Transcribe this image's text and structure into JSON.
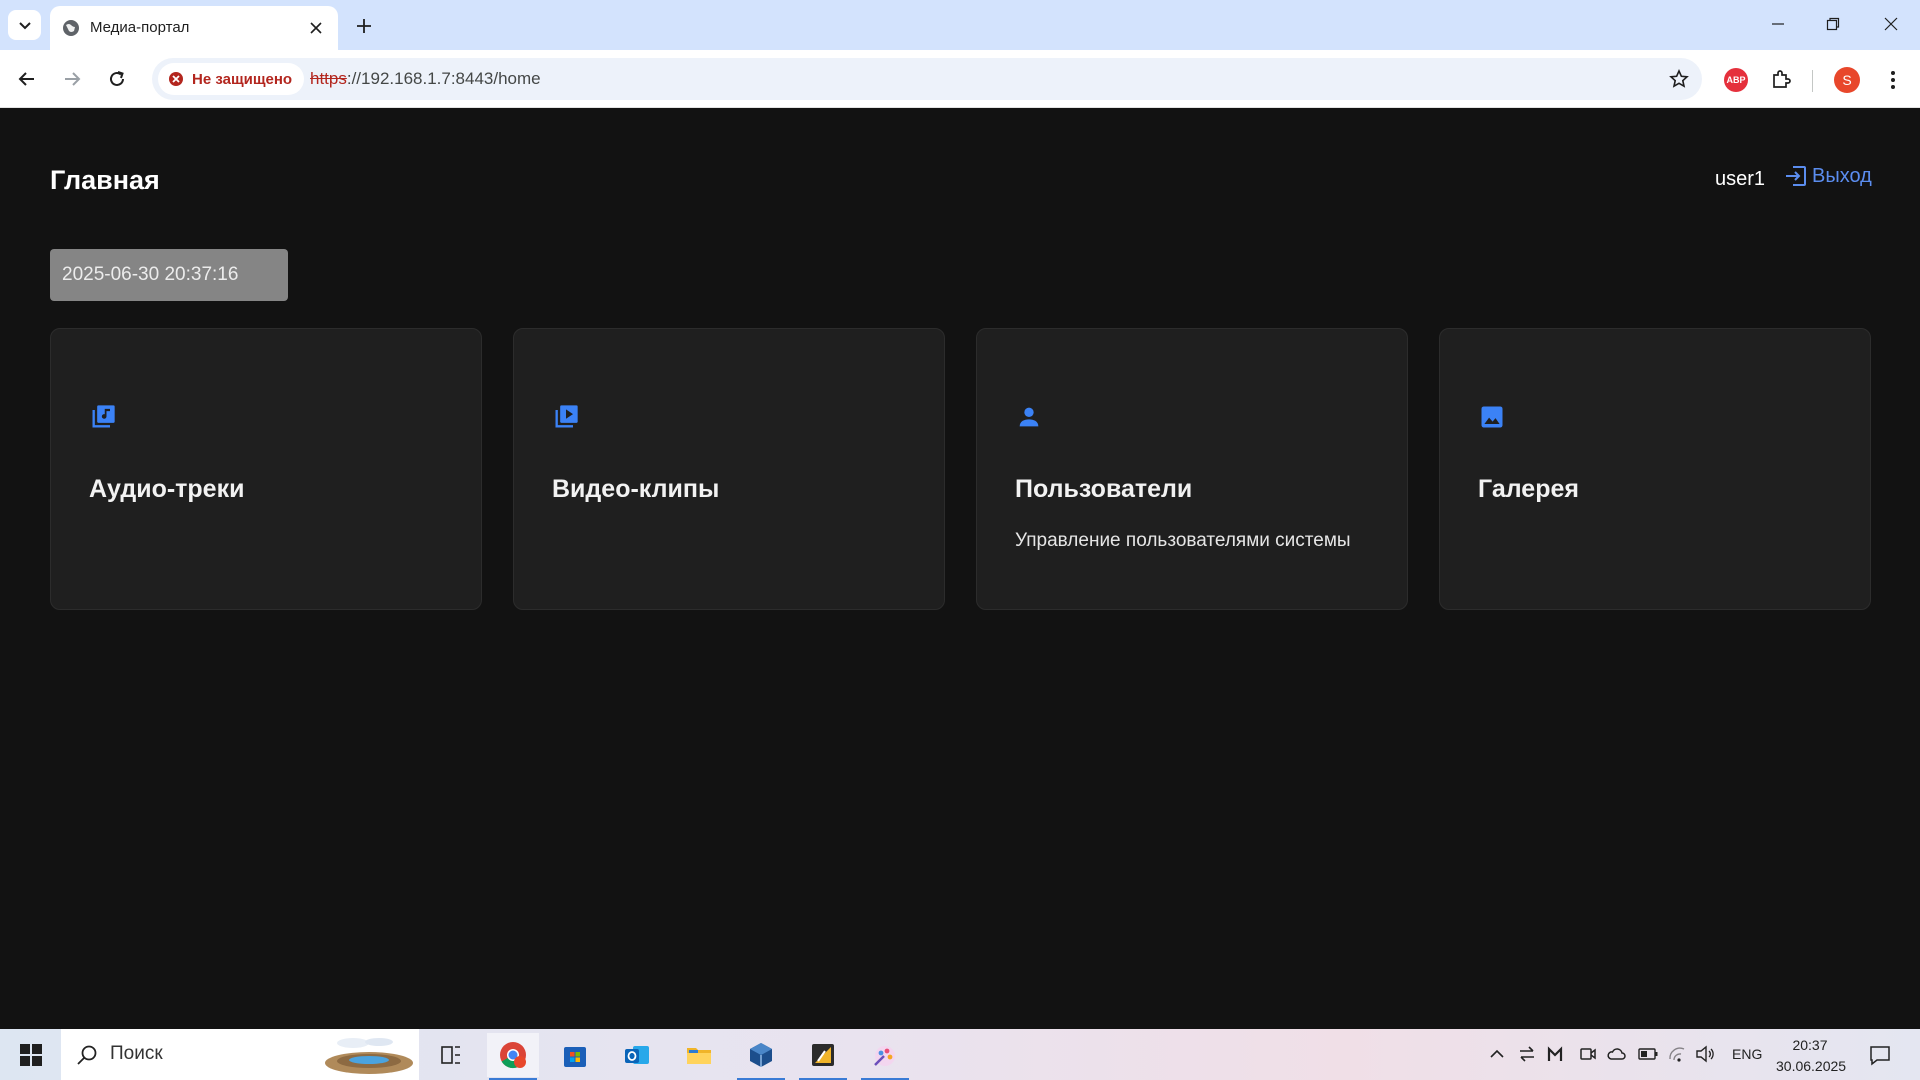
{
  "browser": {
    "tab_title": "Медиа-портал",
    "security_label": "Не защищено",
    "url_scheme": "https",
    "url_rest": "://192.168.1.7:8443/home",
    "profile_initial": "S",
    "extension_abp_label": "ABP"
  },
  "header": {
    "title": "Главная",
    "username": "user1",
    "logout_label": "Выход"
  },
  "datetime": "2025-06-30 20:37:16",
  "cards": [
    {
      "icon": "audio-library-icon",
      "title": "Аудио-треки",
      "description": ""
    },
    {
      "icon": "video-library-icon",
      "title": "Видео-клипы",
      "description": ""
    },
    {
      "icon": "person-icon",
      "title": "Пользователи",
      "description": "Управление пользователями системы"
    },
    {
      "icon": "image-icon",
      "title": "Галерея",
      "description": ""
    }
  ],
  "taskbar": {
    "search_placeholder": "Поиск",
    "language": "ENG",
    "time": "20:37",
    "date": "30.06.2025"
  },
  "colors": {
    "page_background": "#121212",
    "card_background": "#1f1f1f",
    "accent_blue": "#5b8def",
    "insecure_red": "#b3261e"
  }
}
